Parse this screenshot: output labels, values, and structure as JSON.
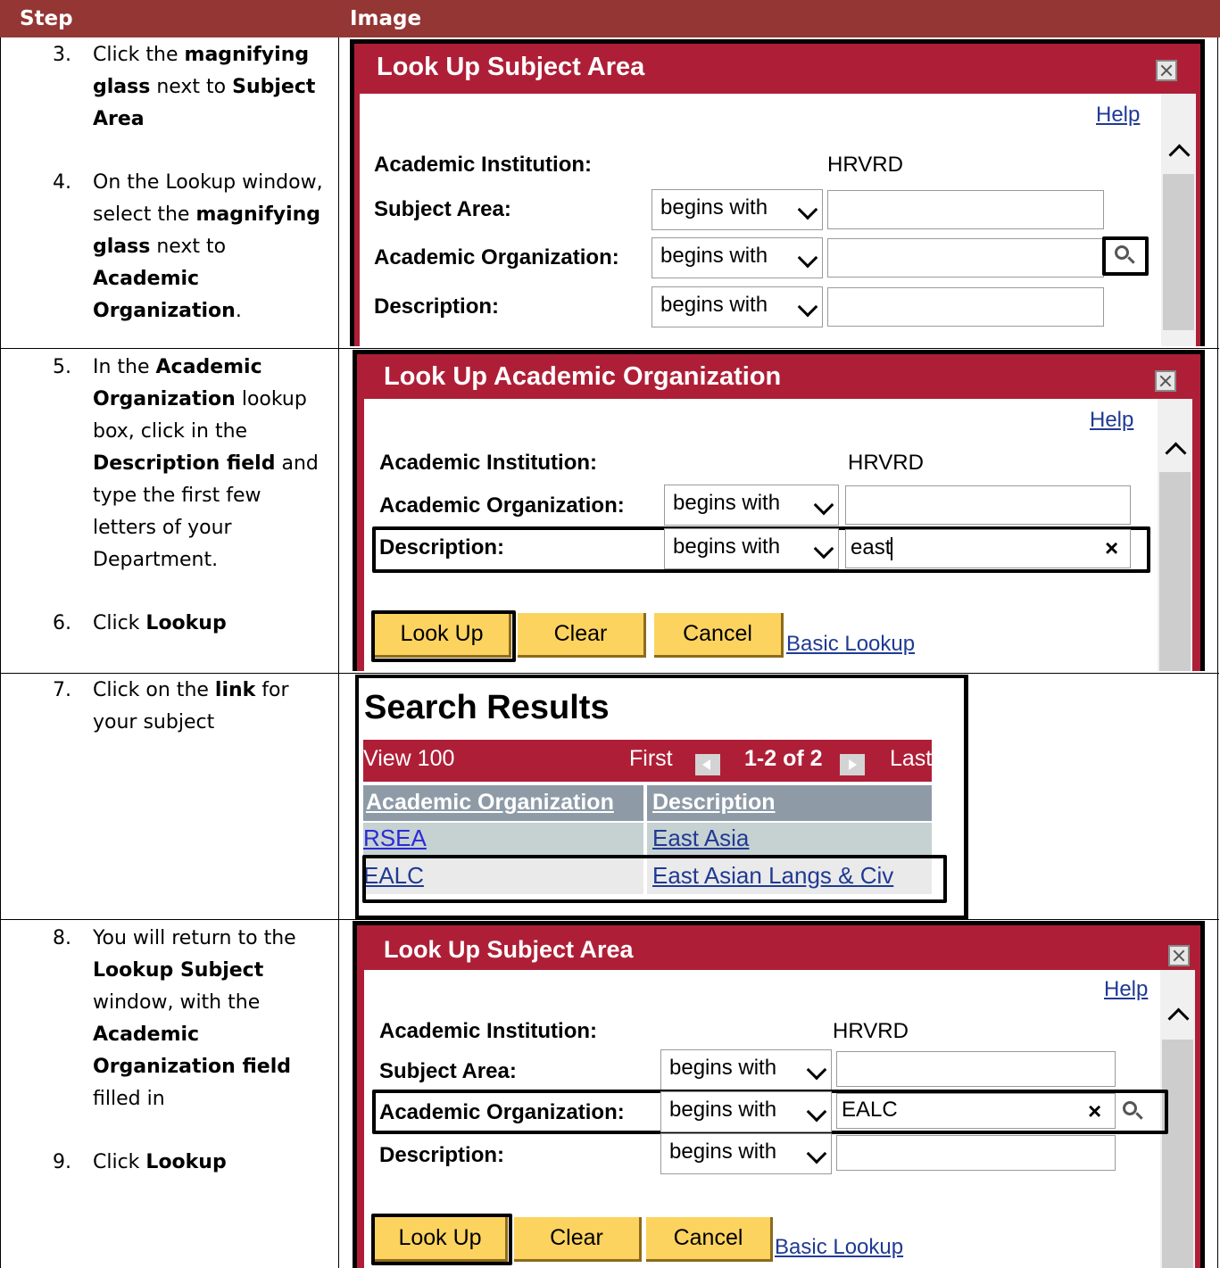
{
  "table": {
    "headers": [
      "Step",
      "Image"
    ],
    "steps": [
      {
        "num": "3.",
        "html": "Click the <b>magnifying glass</b> next to <b>Subject Area</b>"
      },
      {
        "num": "4.",
        "html": "On the Lookup window, select the <b>magnifying glass</b> next to <b>Academic Organization</b>."
      },
      {
        "num": "5.",
        "html": "In the <b>Academic Organization</b> lookup box, click in the <b>Description field</b> and type the first few letters of your Department."
      },
      {
        "num": "6.",
        "html": "Click <b>Lookup</b>"
      },
      {
        "num": "7.",
        "html": "Click on the <b>link</b> for your subject"
      },
      {
        "num": "8.",
        "html": "You will return to the <b>Lookup Subject</b> window, with the <b>Academic Organization field</b> filled in"
      },
      {
        "num": "9.",
        "html": "Click <b>Lookup</b>"
      }
    ]
  },
  "shot1": {
    "title": "Look Up Subject Area",
    "help": "Help",
    "inst_label": "Academic Institution:",
    "inst_value": "HRVRD",
    "subject_label": "Subject Area:",
    "org_label": "Academic Organization:",
    "desc_label": "Description:",
    "op": "begins with"
  },
  "shot2": {
    "title": "Look Up Academic Organization",
    "help": "Help",
    "inst_label": "Academic Institution:",
    "inst_value": "HRVRD",
    "org_label": "Academic Organization:",
    "desc_label": "Description:",
    "op": "begins with",
    "desc_value": "east",
    "clear_x": "×",
    "btn_lookup": "Look Up",
    "btn_clear": "Clear",
    "btn_cancel": "Cancel",
    "basic_lookup": "Basic Lookup"
  },
  "shot3": {
    "title": "Search Results",
    "view": "View 100",
    "first": "First",
    "range": "1-2 of 2",
    "last": "Last",
    "col1": "Academic Organization",
    "col2": "Description",
    "rows": [
      {
        "org": "RSEA",
        "desc": "East Asia"
      },
      {
        "org": "EALC",
        "desc": "East Asian Langs & Civ"
      }
    ]
  },
  "shot4": {
    "title": "Look Up Subject Area",
    "help": "Help",
    "inst_label": "Academic Institution:",
    "inst_value": "HRVRD",
    "subject_label": "Subject Area:",
    "org_label": "Academic Organization:",
    "desc_label": "Description:",
    "op": "begins with",
    "org_value": "EALC",
    "clear_x": "×",
    "btn_lookup": "Look Up",
    "btn_clear": "Clear",
    "btn_cancel": "Cancel",
    "basic_lookup": "Basic Lookup"
  },
  "colors": {
    "header": "#943634",
    "titlebar": "#ae1f37",
    "button": "#fcd35e",
    "grid_header": "#8e9ba7",
    "row_alt": "#c6d1d2"
  }
}
